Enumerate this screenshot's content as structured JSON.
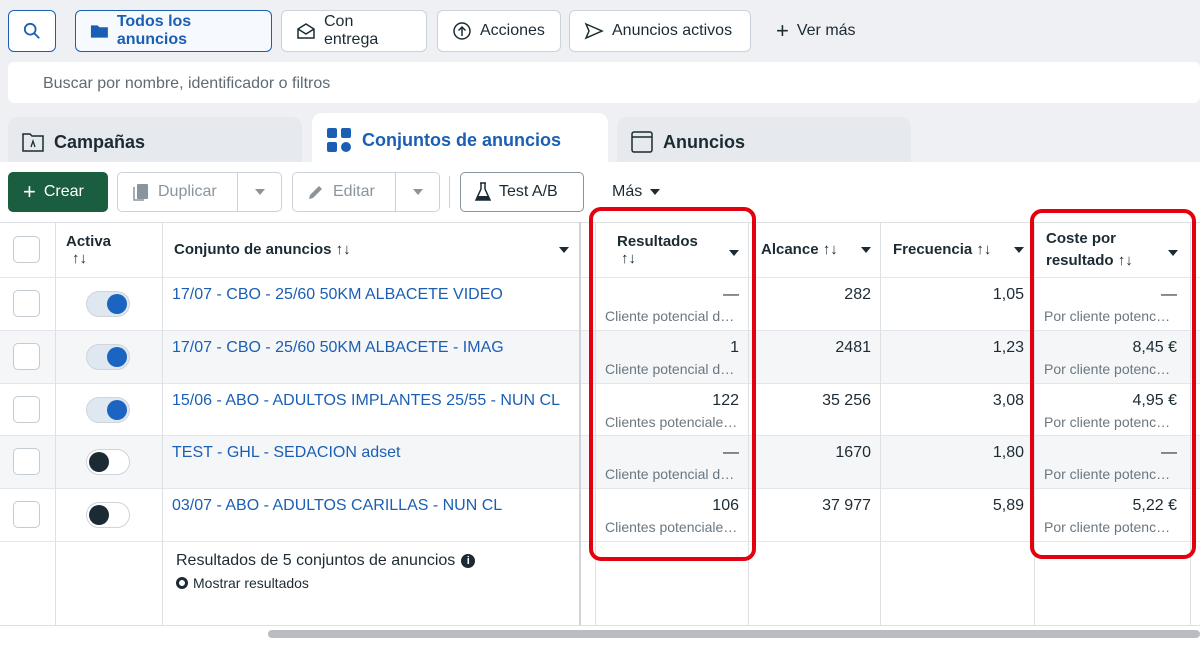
{
  "filters": {
    "search_icon": "search-icon",
    "items": [
      {
        "label": "Todos los anuncios",
        "icon": "folder-icon"
      },
      {
        "label": "Con entrega",
        "icon": "envelope-icon"
      },
      {
        "label": "Acciones",
        "icon": "arrow-up-circle-icon"
      },
      {
        "label": "Anuncios activos",
        "icon": "send-icon"
      }
    ],
    "more": "Ver más"
  },
  "search": {
    "placeholder": "Buscar por nombre, identificador o filtros"
  },
  "tabs": [
    {
      "label": "Campañas"
    },
    {
      "label": "Conjuntos de anuncios",
      "selected": true
    },
    {
      "label": "Anuncios"
    }
  ],
  "toolbar": {
    "create": "Crear",
    "duplicate": "Duplicar",
    "edit": "Editar",
    "ab_test": "Test A/B",
    "more": "Más"
  },
  "table": {
    "headers": {
      "active": "Activa",
      "name": "Conjunto de anuncios",
      "results": "Resultados",
      "reach": "Alcance",
      "frequency": "Frecuencia",
      "cost_line1": "Coste por",
      "cost_line2": "resultado",
      "sort": "↑↓"
    },
    "rows": [
      {
        "active": true,
        "name": "17/07 - CBO - 25/60 50KM ALBACETE VIDEO",
        "results": "—",
        "results_sub": "Cliente potencial de …",
        "reach": "282",
        "frequency": "1,05",
        "cost": "—",
        "cost_sub": "Por cliente potenci…"
      },
      {
        "active": true,
        "name": "17/07 - CBO - 25/60 50KM ALBACETE - IMAG",
        "results": "1",
        "results_sub": "Cliente potencial de …",
        "reach": "2481",
        "frequency": "1,23",
        "cost": "8,45 €",
        "cost_sub": "Por cliente potenci…"
      },
      {
        "active": true,
        "name": "15/06 - ABO - ADULTOS IMPLANTES 25/55 - NUN CL",
        "results": "122",
        "results_sub": "Clientes potenciales…",
        "reach": "35 256",
        "frequency": "3,08",
        "cost": "4,95 €",
        "cost_sub": "Por cliente potenci…"
      },
      {
        "active": false,
        "name": "TEST - GHL - SEDACION adset",
        "results": "—",
        "results_sub": "Cliente potencial de …",
        "reach": "1670",
        "frequency": "1,80",
        "cost": "—",
        "cost_sub": "Por cliente potenci…"
      },
      {
        "active": false,
        "name": "03/07 - ABO - ADULTOS CARILLAS - NUN CL",
        "results": "106",
        "results_sub": "Clientes potenciales…",
        "reach": "37 977",
        "frequency": "5,89",
        "cost": "5,22 €",
        "cost_sub": "Por cliente potenci…"
      }
    ],
    "footer": {
      "summary": "Resultados de 5 conjuntos de anuncios",
      "show": "Mostrar resultados"
    }
  },
  "colors": {
    "accent": "#1b5fb4",
    "create": "#1a5d3f",
    "highlight": "#e3000f"
  }
}
